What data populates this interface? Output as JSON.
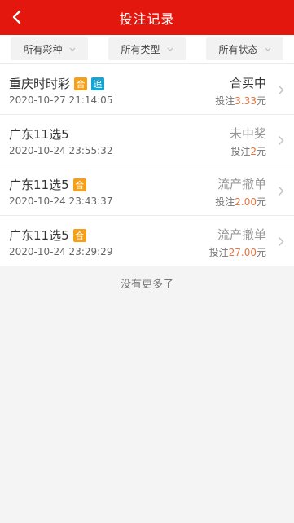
{
  "header": {
    "title": "投注记录",
    "back_icon": "chevron-left-icon",
    "bg_color": "#e3170d"
  },
  "filters": [
    {
      "label": "所有彩种"
    },
    {
      "label": "所有类型"
    },
    {
      "label": "所有状态"
    }
  ],
  "records": [
    {
      "name": "重庆时时彩",
      "badges": [
        "合",
        "追"
      ],
      "time": "2020-10-27 21:14:05",
      "status": "合买中",
      "status_color": "#333333",
      "bet_prefix": "投注",
      "amount": "3.33",
      "unit": "元"
    },
    {
      "name": "广东11选5",
      "badges": [],
      "time": "2020-10-24 23:55:32",
      "status": "未中奖",
      "status_color": "#999999",
      "bet_prefix": "投注",
      "amount": "2",
      "unit": "元"
    },
    {
      "name": "广东11选5",
      "badges": [
        "合"
      ],
      "time": "2020-10-24 23:43:37",
      "status": "流产撤单",
      "status_color": "#999999",
      "bet_prefix": "投注",
      "amount": "2.00",
      "unit": "元"
    },
    {
      "name": "广东11选5",
      "badges": [
        "合"
      ],
      "time": "2020-10-24 23:29:29",
      "status": "流产撤单",
      "status_color": "#999999",
      "bet_prefix": "投注",
      "amount": "27.00",
      "unit": "元"
    }
  ],
  "footer": {
    "no_more": "没有更多了"
  }
}
